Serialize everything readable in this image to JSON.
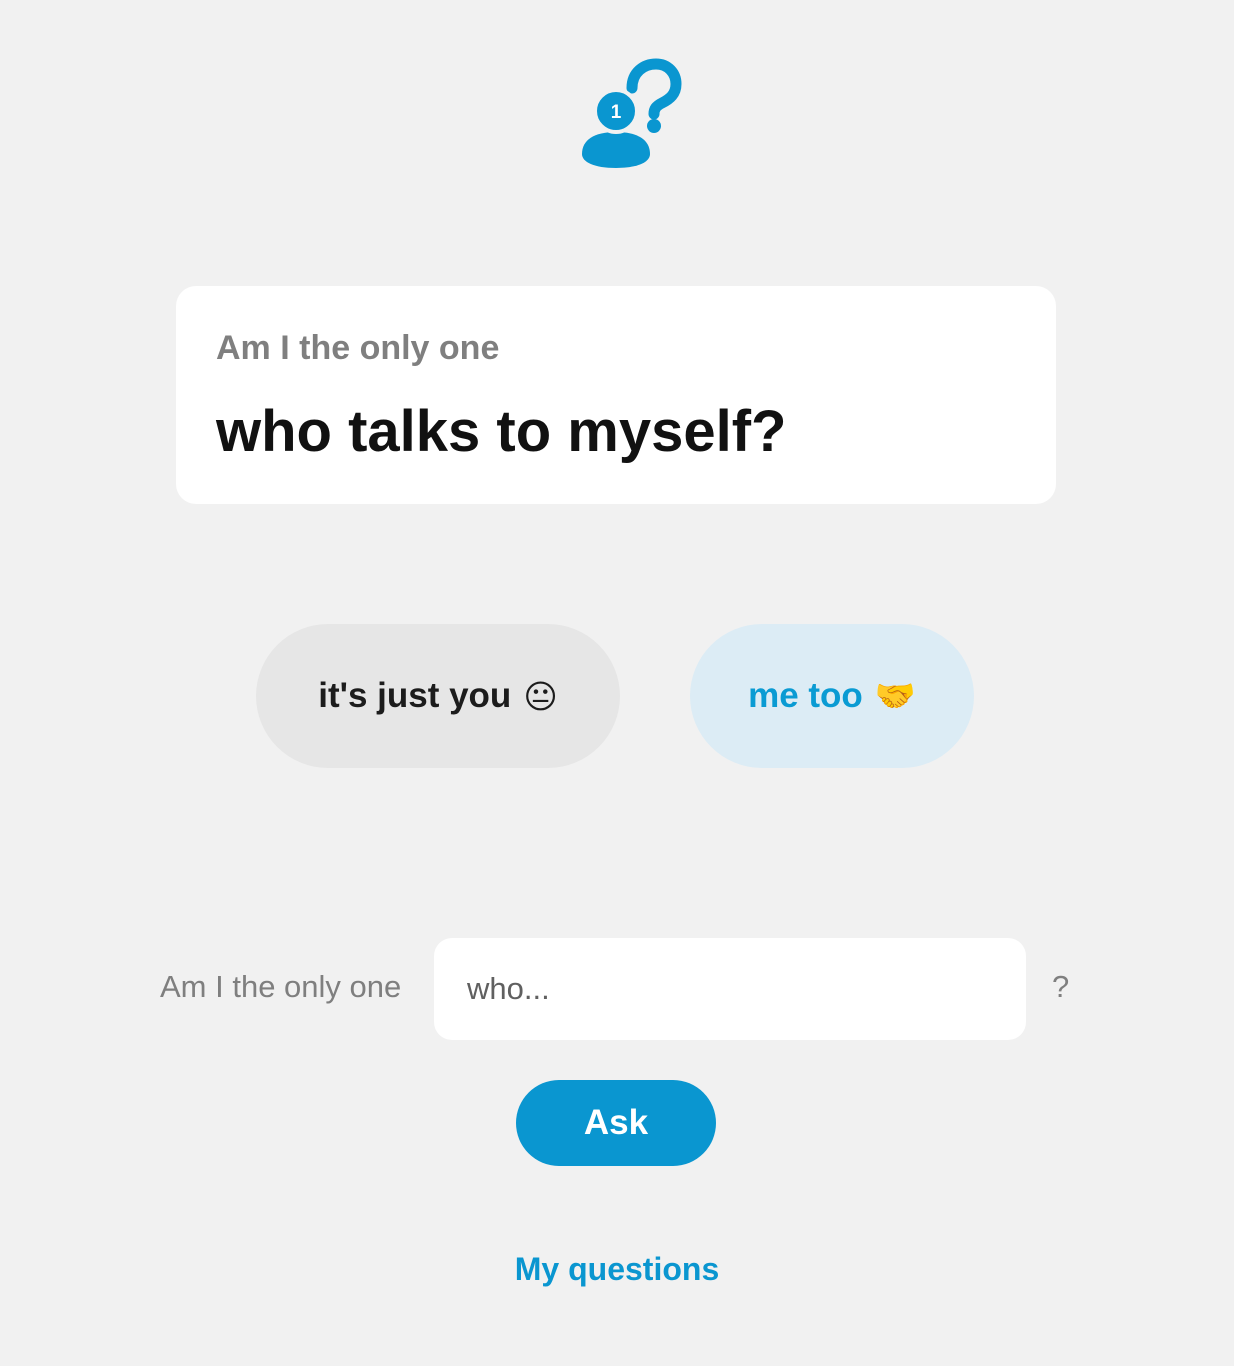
{
  "brand": {
    "logo_icon": "person-question-icon",
    "logo_badge": "1",
    "accent_color": "#0a96d0"
  },
  "question": {
    "prefix": "Am I the only one",
    "text": "who talks to myself?"
  },
  "answers": {
    "no_label": "it's just you",
    "no_emoji": "😐",
    "yes_label": "me too",
    "yes_emoji": "🤝"
  },
  "ask": {
    "prefix": "Am I the only one",
    "placeholder": "who...",
    "suffix": "?",
    "button_label": "Ask"
  },
  "footer": {
    "my_questions_label": "My questions"
  }
}
